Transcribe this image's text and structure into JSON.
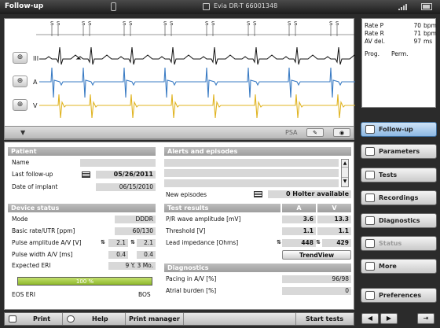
{
  "topbar": {
    "title": "Follow-up",
    "device": "Evia DR-T 66001348"
  },
  "info": {
    "rows": [
      {
        "k": "Rate P",
        "v": "70",
        "u": "bpm"
      },
      {
        "k": "Rate R",
        "v": "71",
        "u": "bpm"
      },
      {
        "k": "AV del.",
        "v": "97",
        "u": "ms"
      },
      {
        "k": "Prog.",
        "v": "Perm.",
        "u": ""
      }
    ]
  },
  "ecg": {
    "markers": [
      "S",
      "S",
      "S",
      "S",
      "S",
      "S",
      "S",
      "S",
      "S",
      "S",
      "S",
      "S",
      "S",
      "S",
      "S",
      "S"
    ],
    "leads": [
      "III",
      "A",
      "V"
    ],
    "psa_label": "PSA",
    "dropdown": "▼"
  },
  "nav": [
    {
      "label": "Follow-up",
      "icon": "heart-icon",
      "state": "active"
    },
    {
      "label": "Parameters",
      "icon": "parameters-icon",
      "state": "normal"
    },
    {
      "label": "Tests",
      "icon": "tests-icon",
      "state": "normal"
    },
    {
      "label": "Recordings",
      "icon": "recordings-icon",
      "state": "normal"
    },
    {
      "label": "Diagnostics",
      "icon": "diagnostics-icon",
      "state": "normal"
    },
    {
      "label": "Status",
      "icon": "status-icon",
      "state": "disabled"
    },
    {
      "label": "More",
      "icon": "more-icon",
      "state": "normal"
    },
    {
      "label": "Preferences",
      "icon": "preferences-icon",
      "state": "normal"
    }
  ],
  "patient": {
    "header": "Patient",
    "name_label": "Name",
    "last_followup_label": "Last follow-up",
    "last_followup": "05/26/2011",
    "implant_label": "Date of implant",
    "implant": "06/15/2010"
  },
  "device_status": {
    "header": "Device status",
    "rows": [
      {
        "label": "Mode",
        "value": "DDDR"
      },
      {
        "label": "Basic rate/UTR [ppm]",
        "value": "60/130"
      },
      {
        "label": "Pulse amplitude A/V [V]",
        "a": "2.1",
        "v": "2.1"
      },
      {
        "label": "Pulse width A/V [ms]",
        "a": "0.4",
        "v": "0.4"
      },
      {
        "label": "Expected ERI",
        "value": "9 Y. 3 Mo."
      }
    ],
    "battery_percent": 100,
    "battery_label": "100 %",
    "eos_eri": "EOS ERI",
    "bos": "BOS"
  },
  "alerts": {
    "header": "Alerts and episodes",
    "new_episodes_label": "New episodes",
    "new_episodes": "0 Holter available"
  },
  "test_results": {
    "header": "Test results",
    "col_a": "A",
    "col_v": "V",
    "rows": [
      {
        "label": "P/R wave amplitude [mV]",
        "a": "3.6",
        "v": "13.3"
      },
      {
        "label": "Threshold [V]",
        "a": "1.1",
        "v": "1.1"
      },
      {
        "label": "Lead impedance [Ohms]",
        "a": "448",
        "v": "429"
      }
    ],
    "trendview": "TrendView"
  },
  "diagnostics": {
    "header": "Diagnostics",
    "rows": [
      {
        "label": "Pacing in A/V [%]",
        "value": "96/98"
      },
      {
        "label": "Atrial burden [%]",
        "value": "0"
      }
    ]
  },
  "bottom": {
    "print": "Print",
    "help": "Help",
    "print_manager": "Print manager",
    "start_tests": "Start tests"
  }
}
